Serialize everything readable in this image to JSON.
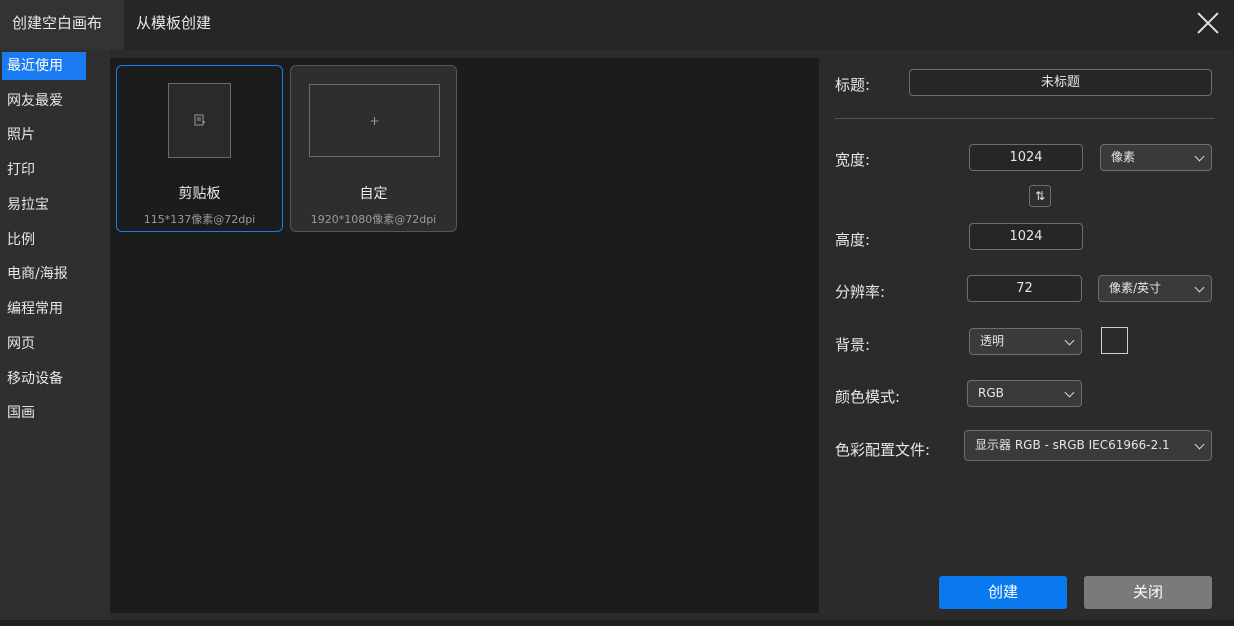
{
  "tabs": {
    "blank": "创建空白画布",
    "template": "从模板创建"
  },
  "categories": [
    "最近使用",
    "网友最爱",
    "照片",
    "打印",
    "易拉宝",
    "比例",
    "电商/海报",
    "编程常用",
    "网页",
    "移动设备",
    "国画"
  ],
  "cards": [
    {
      "name": "剪贴板",
      "sub": "115*137像素@72dpi",
      "icon": "clipboard-icon"
    },
    {
      "name": "自定",
      "sub": "1920*1080像素@72dpi",
      "icon": "plus-icon"
    }
  ],
  "form": {
    "title_label": "标题:",
    "title_value": "未标题",
    "width_label": "宽度:",
    "width_value": "1024",
    "width_unit": "像素",
    "height_label": "高度:",
    "height_value": "1024",
    "resolution_label": "分辨率:",
    "resolution_value": "72",
    "resolution_unit": "像素/英寸",
    "background_label": "背景:",
    "background_value": "透明",
    "color_mode_label": "颜色模式:",
    "color_mode_value": "RGB",
    "profile_label": "色彩配置文件:",
    "profile_value": "显示器 RGB - sRGB IEC61966-2.1"
  },
  "buttons": {
    "create": "创建",
    "close": "关闭"
  },
  "colors": {
    "accent": "#0a79f0",
    "bg": "#2b2b2b",
    "canvas": "#1c1c1c"
  }
}
